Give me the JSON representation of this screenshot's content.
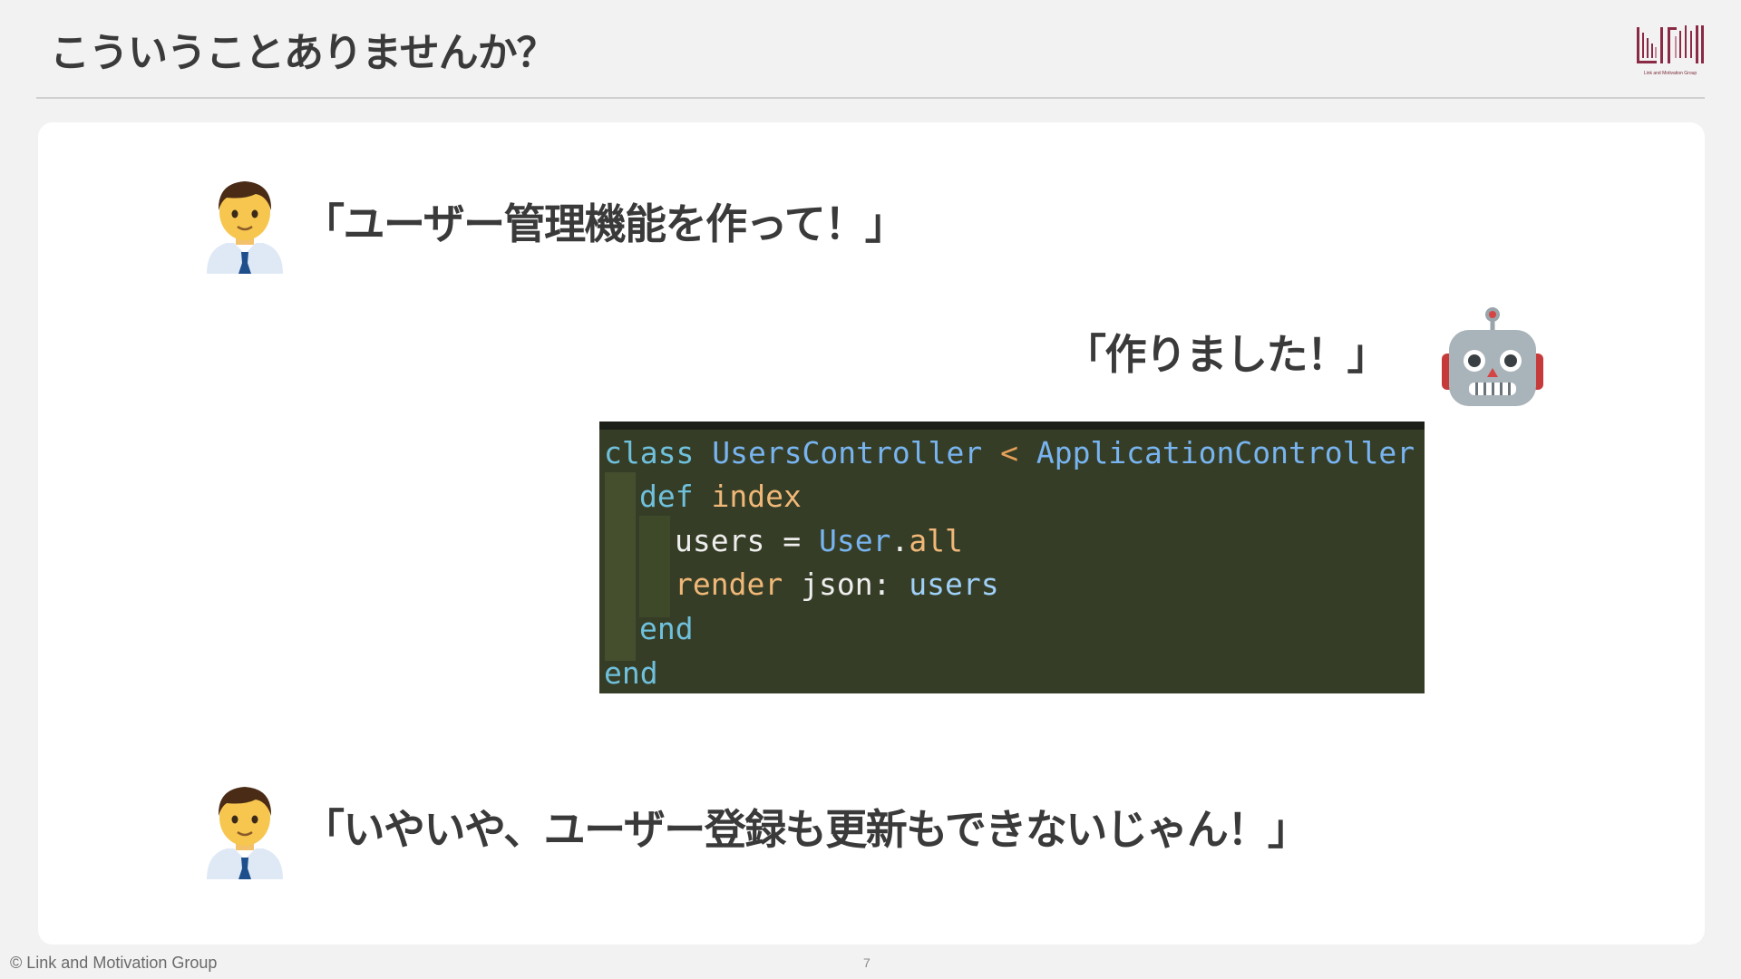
{
  "slide": {
    "title": "こういうことありませんか？",
    "logo_caption": "Link and Motivation Group",
    "footer_copyright": "© Link and Motivation Group",
    "page_number": "7"
  },
  "dialogue": {
    "request": "「ユーザー管理機能を作って！」",
    "reply": "「作りました！」",
    "complaint": "「いやいや、ユーザー登録も更新もできないじゃん！」"
  },
  "icons": {
    "person": "man-office-worker-icon",
    "robot": "robot-face-icon",
    "logo": "link-and-motivation-logo"
  },
  "code": {
    "lines": [
      [
        {
          "text": "class",
          "color": "#6fc0dc"
        },
        {
          "text": " ",
          "color": "#ffffff"
        },
        {
          "text": "UsersController",
          "color": "#78b4f0"
        },
        {
          "text": " < ",
          "color": "#e6a05a"
        },
        {
          "text": "ApplicationController",
          "color": "#78b4f0"
        }
      ],
      [
        {
          "text": "def",
          "color": "#6fc0dc"
        },
        {
          "text": " ",
          "color": "#ffffff"
        },
        {
          "text": "index",
          "color": "#f0b878"
        }
      ],
      [
        {
          "text": "users",
          "color": "#eeeeee"
        },
        {
          "text": " = ",
          "color": "#eeeeee"
        },
        {
          "text": "User",
          "color": "#78b4f0"
        },
        {
          "text": ".",
          "color": "#eeeeee"
        },
        {
          "text": "all",
          "color": "#f0b878"
        }
      ],
      [
        {
          "text": "render",
          "color": "#f0b878"
        },
        {
          "text": " json: ",
          "color": "#eeeeee"
        },
        {
          "text": "users",
          "color": "#9fd0f8"
        }
      ],
      [
        {
          "text": "end",
          "color": "#6fc0dc"
        }
      ],
      [
        {
          "text": "end",
          "color": "#6fc0dc"
        }
      ]
    ]
  },
  "colors": {
    "text": "#3a3a3a",
    "code_background": "#363d26",
    "logo": "#8a2a44"
  }
}
